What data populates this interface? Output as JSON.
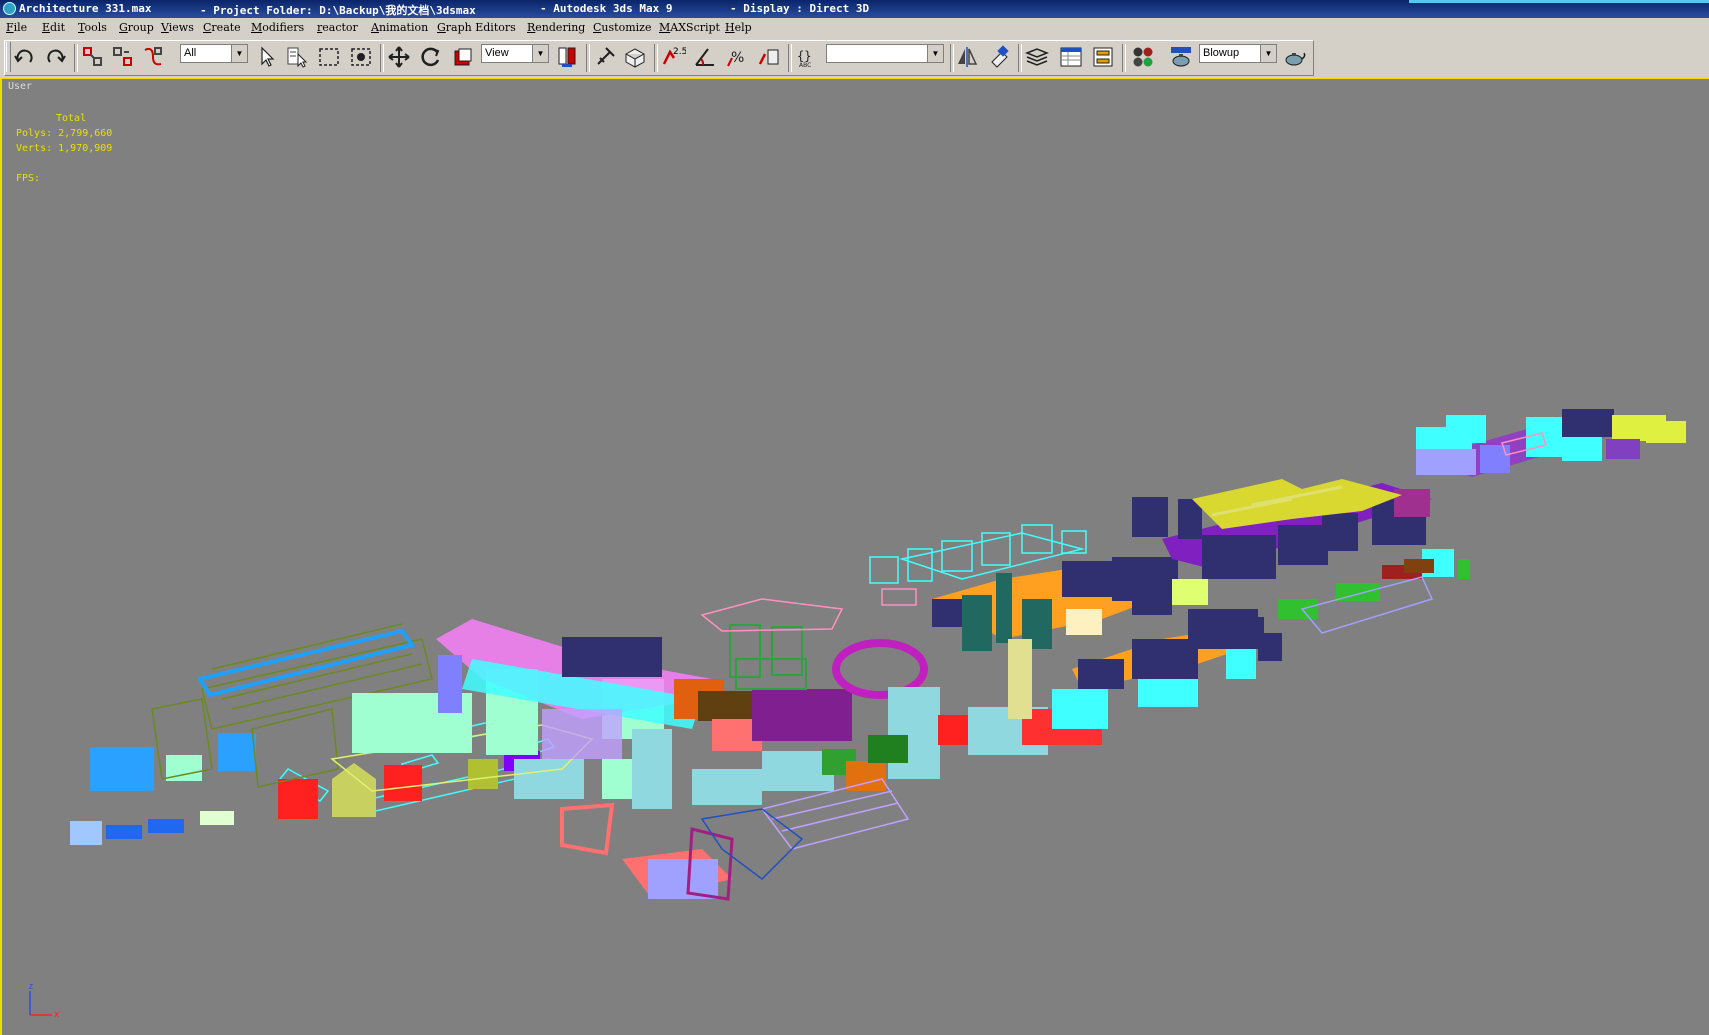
{
  "titlebar": {
    "file": "Architecture 331.max",
    "project": "- Project Folder: D:\\Backup\\我的文档\\3dsmax",
    "app": "- Autodesk 3ds Max 9",
    "display": "- Display : Direct 3D"
  },
  "menubar": {
    "items": [
      "File",
      "Edit",
      "Tools",
      "Group",
      "Views",
      "Create",
      "Modifiers",
      "reactor",
      "Animation",
      "Graph Editors",
      "Rendering",
      "Customize",
      "MAXScript",
      "Help"
    ]
  },
  "toolbar": {
    "selection_filter": "All",
    "reference_coord": "View",
    "named_selection": "",
    "render_preset": "Blowup",
    "snap_label": "2.5"
  },
  "viewport": {
    "label": "User",
    "stats_title": "Total",
    "polys": "Polys: 2,799,660",
    "verts": "Verts: 1,970,909",
    "fps": "FPS:",
    "axis_z": "z",
    "axis_x": "x"
  },
  "icons": [
    "undo-icon",
    "redo-icon",
    "select-link-icon",
    "unlink-icon",
    "bind-spacewarp-icon",
    "select-icon",
    "select-by-name-icon",
    "rect-region-icon",
    "window-crossing-icon",
    "move-icon",
    "rotate-icon",
    "scale-icon",
    "pivot-icon",
    "manipulate-icon",
    "snap-icon",
    "angle-snap-icon",
    "percent-snap-icon",
    "spinner-snap-icon",
    "edit-named-sel-icon",
    "mirror-icon",
    "align-icon",
    "layer-icon",
    "curve-editor-icon",
    "schematic-icon",
    "material-editor-icon",
    "render-scene-icon",
    "quick-render-icon"
  ]
}
